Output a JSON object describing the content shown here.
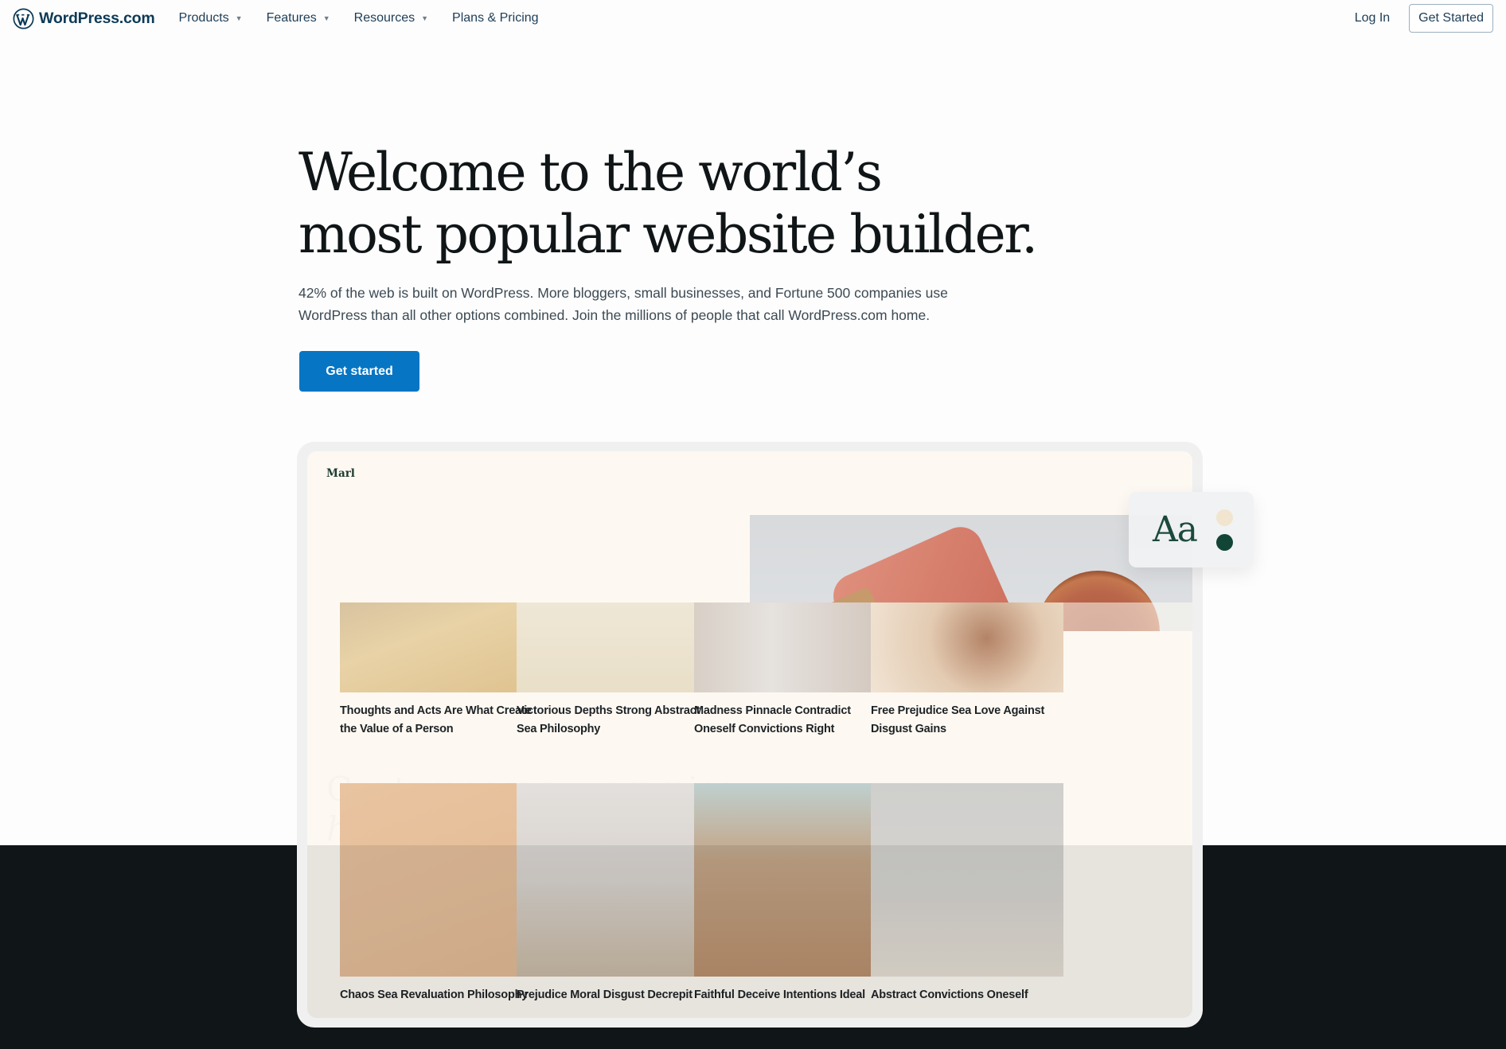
{
  "nav": {
    "brand": "WordPress.com",
    "items": [
      {
        "label": "Products",
        "has_dropdown": true
      },
      {
        "label": "Features",
        "has_dropdown": true
      },
      {
        "label": "Resources",
        "has_dropdown": true
      },
      {
        "label": "Plans & Pricing",
        "has_dropdown": false
      }
    ],
    "caret": "▼",
    "login": "Log In",
    "get_started": "Get Started"
  },
  "hero": {
    "title_line1": "Welcome to the world’s",
    "title_line2": "most popular website builder.",
    "description": "42% of the web is built on WordPress. More bloggers, small businesses, and Fortune 500 companies use WordPress than all other options combined. Join the millions of people that call WordPress.com home.",
    "cta": "Get started"
  },
  "preview": {
    "site_name": "Marl",
    "ghost_heading_line1": "Contemporary ceramics,",
    "ghost_heading_line2": "handmade in Australia",
    "posts": [
      {
        "title": "Thoughts and Acts Are What Create the Value of a Person",
        "image": "magazines-on-wood"
      },
      {
        "title": "Victorious Depths Strong Abstract Sea Philosophy",
        "image": "dried-flowers"
      },
      {
        "title": "Madness Pinnacle Contradict Oneself Convictions Right",
        "image": "marble-ring-vase"
      },
      {
        "title": "Free Prejudice Sea Love Against Disgust Gains",
        "image": "sand-pouring"
      },
      {
        "title": "Chaos Sea Revaluation Philosophy",
        "image": "dropper-bottles"
      },
      {
        "title": "Prejudice Moral Disgust Decrepit",
        "image": "stacked-stones"
      },
      {
        "title": "Faithful Deceive Intentions Ideal",
        "image": "blurred-building"
      },
      {
        "title": "Abstract Convictions Oneself",
        "image": "hourglass-books"
      }
    ],
    "style_picker": {
      "sample": "Aa",
      "colors": [
        "#f1e5cf",
        "#134537"
      ]
    }
  },
  "colors": {
    "brand_blue": "#0675c4",
    "nav_text": "#1d3d57",
    "footer_dark": "#101517",
    "preview_bg": "#fdf9f2"
  }
}
